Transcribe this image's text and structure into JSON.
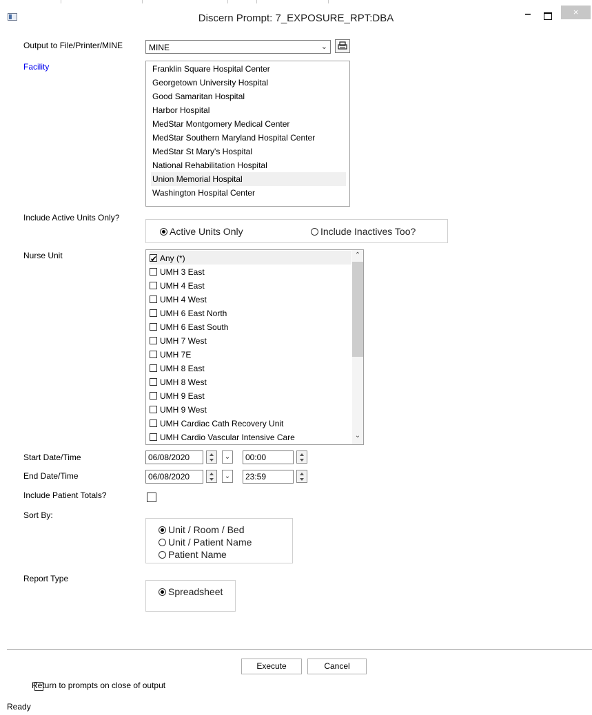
{
  "window": {
    "title": "Discern Prompt: 7_EXPOSURE_RPT:DBA",
    "minimize_glyph": "–",
    "close_glyph": "×"
  },
  "output": {
    "label": "Output to File/Printer/MINE",
    "value": "MINE"
  },
  "facility": {
    "label": "Facility",
    "items": [
      "Franklin Square Hospital Center",
      "Georgetown University Hospital",
      "Good Samaritan Hospital",
      "Harbor Hospital",
      "MedStar Montgomery Medical Center",
      "MedStar Southern Maryland Hospital Center",
      "MedStar St Mary's Hospital",
      "National Rehabilitation Hospital",
      "Union Memorial Hospital",
      "Washington Hospital Center"
    ],
    "selected": "Union Memorial Hospital"
  },
  "active_units": {
    "label": "Include Active Units Only?",
    "options": [
      "Active Units Only",
      "Include Inactives Too?"
    ],
    "selected": "Active Units Only"
  },
  "nurse_unit": {
    "label": "Nurse Unit",
    "items": [
      "Any (*)",
      "UMH 3 East",
      "UMH 4 East",
      "UMH 4 West",
      "UMH 6 East North",
      "UMH 6 East South",
      "UMH 7 West",
      "UMH 7E",
      "UMH 8 East",
      "UMH 8 West",
      "UMH 9 East",
      "UMH 9 West",
      "UMH Cardiac Cath Recovery Unit",
      "UMH Cardio Vascular Intensive Care"
    ],
    "checked": [
      "Any (*)"
    ]
  },
  "start": {
    "label": "Start Date/Time",
    "date": "06/08/2020",
    "time": "00:00"
  },
  "end": {
    "label": "End Date/Time",
    "date": "06/08/2020",
    "time": "23:59"
  },
  "patient_totals": {
    "label": "Include Patient Totals?",
    "checked": false
  },
  "sort_by": {
    "label": "Sort By:",
    "options": [
      "Unit / Room / Bed",
      "Unit / Patient Name",
      "Patient Name"
    ],
    "selected": "Unit / Room / Bed"
  },
  "report_type": {
    "label": "Report Type",
    "options": [
      "Spreadsheet"
    ],
    "selected": "Spreadsheet"
  },
  "buttons": {
    "execute": "Execute",
    "cancel": "Cancel"
  },
  "return_prompts": {
    "label": "Return to prompts on close of output",
    "checked": false
  },
  "status": "Ready",
  "colors": {
    "facility_label": "#0000ee",
    "close_button_bg": "#c7c7c7",
    "selection_bg": "#f0f0f0"
  },
  "icons": {
    "app": "app-window-icon",
    "print": "printer-icon",
    "dropdown": "chevron-down-icon",
    "spin": "spinner-updown-icon"
  }
}
